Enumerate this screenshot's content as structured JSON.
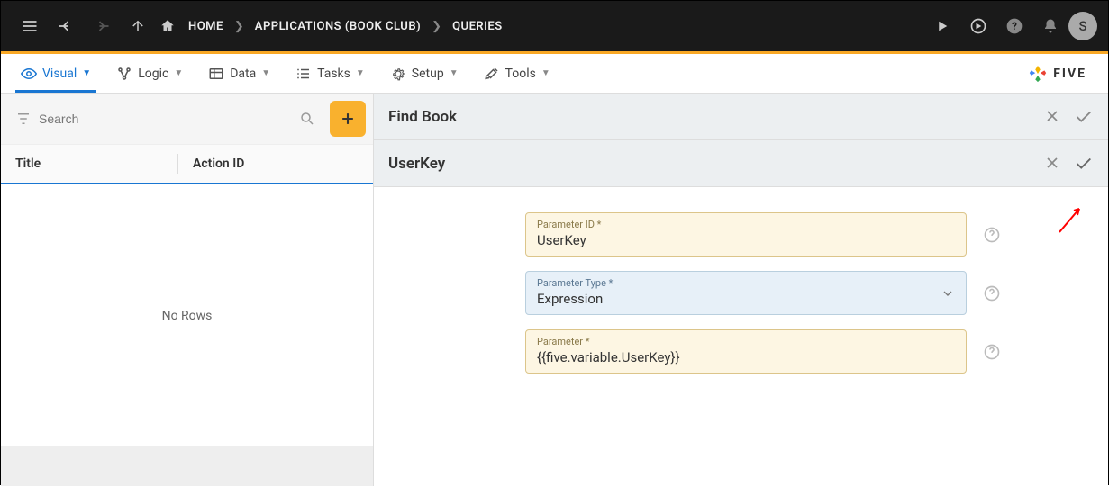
{
  "topbar": {
    "breadcrumb": [
      "HOME",
      "APPLICATIONS (BOOK CLUB)",
      "QUERIES"
    ],
    "avatar_initial": "S"
  },
  "tabs": [
    {
      "label": "Visual",
      "icon": "eye-icon",
      "active": true
    },
    {
      "label": "Logic",
      "icon": "logic-icon",
      "active": false
    },
    {
      "label": "Data",
      "icon": "data-icon",
      "active": false
    },
    {
      "label": "Tasks",
      "icon": "tasks-icon",
      "active": false
    },
    {
      "label": "Setup",
      "icon": "gear-icon",
      "active": false
    },
    {
      "label": "Tools",
      "icon": "tools-icon",
      "active": false
    }
  ],
  "logo_text": "FIVE",
  "left_panel": {
    "search_placeholder": "Search",
    "columns": [
      "Title",
      "Action ID"
    ],
    "empty_text": "No Rows"
  },
  "panel1": {
    "title": "Find Book"
  },
  "panel2": {
    "title": "UserKey"
  },
  "form": {
    "parameter_id": {
      "label": "Parameter ID *",
      "value": "UserKey"
    },
    "parameter_type": {
      "label": "Parameter Type *",
      "value": "Expression"
    },
    "parameter": {
      "label": "Parameter *",
      "value": "{{five.variable.UserKey}}"
    }
  }
}
